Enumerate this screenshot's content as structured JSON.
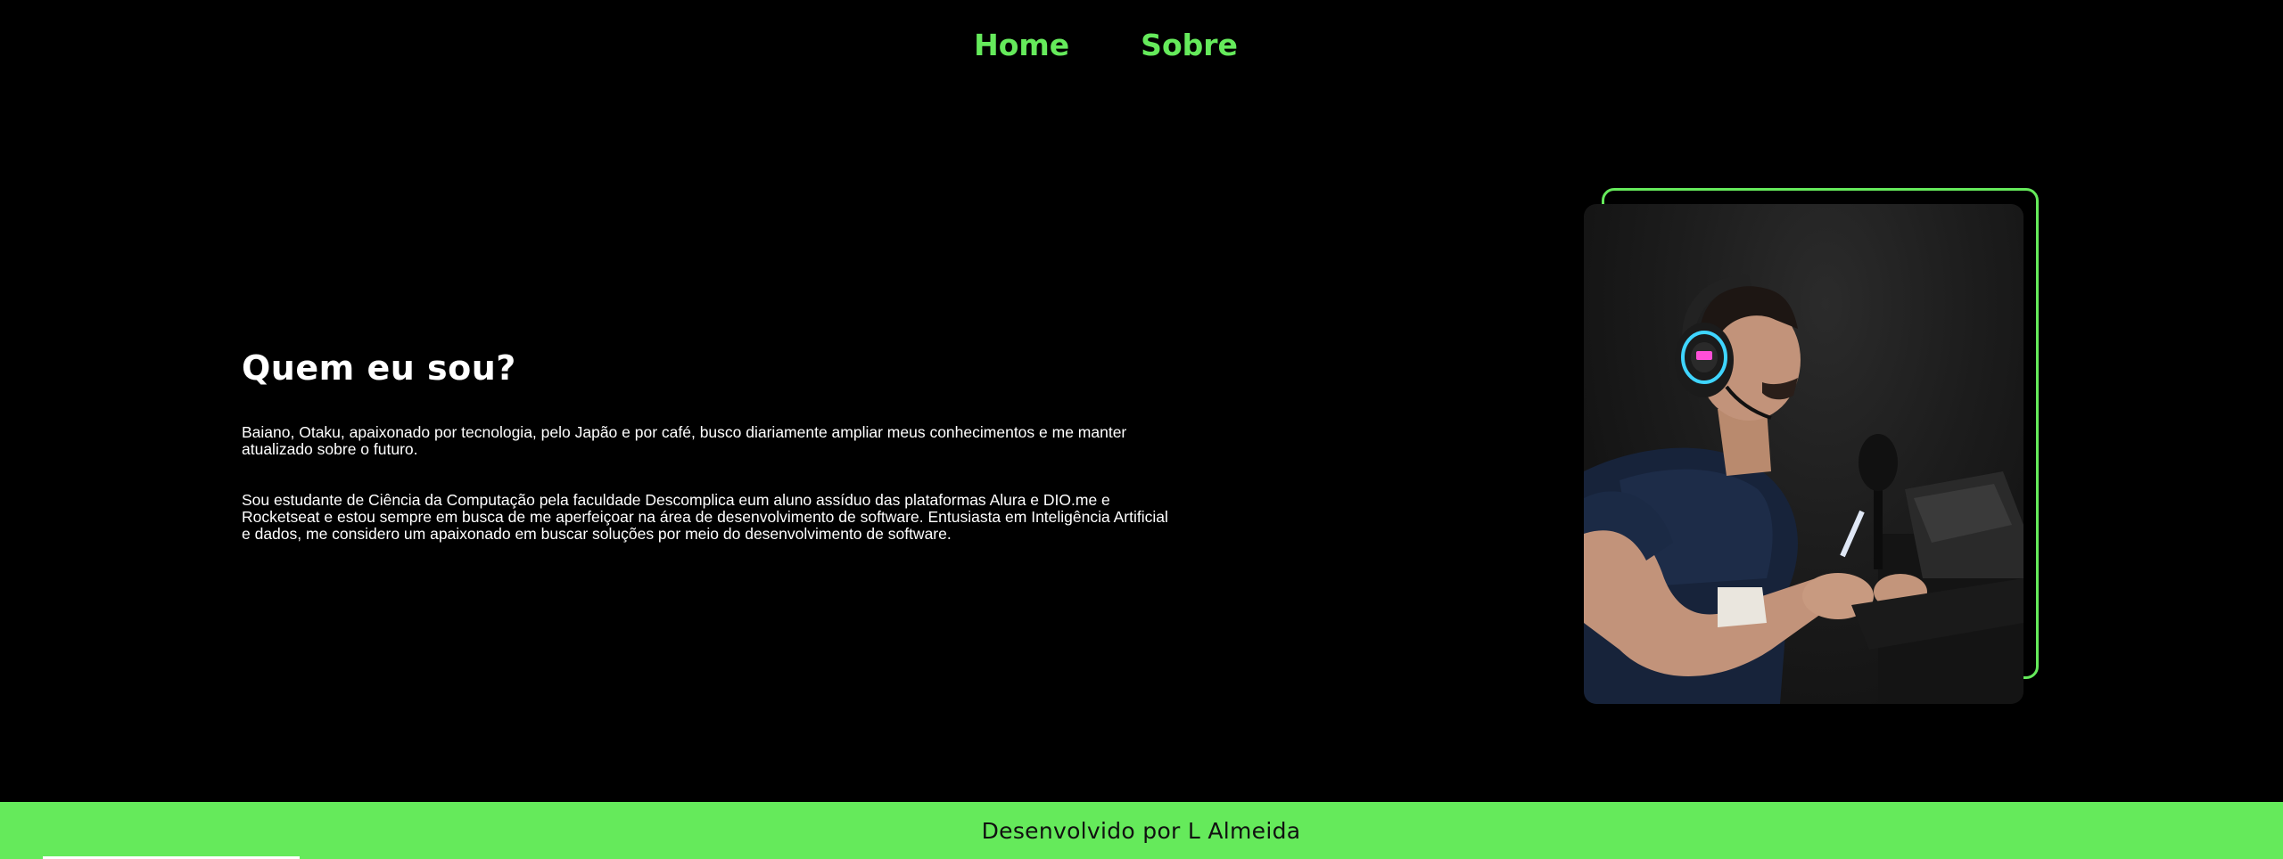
{
  "nav": {
    "items": [
      {
        "label": "Home"
      },
      {
        "label": "Sobre"
      }
    ]
  },
  "about": {
    "title": "Quem eu sou?",
    "paragraphs": [
      "Baiano, Otaku, apaixonado por tecnologia, pelo Japão e por café, busco diariamente ampliar meus conhecimentos e me manter atualizado sobre o futuro.",
      "Sou estudante de Ciência da Computação pela faculdade Descomplica eum aluno assíduo das plataformas Alura e DIO.me e Rocketseat e estou sempre em busca de me aperfeiçoar na área de desenvolvimento de software. Entusiasta em Inteligência Artificial e dados, me considero um apaixonado em buscar soluções por meio do desenvolvimento de software."
    ]
  },
  "footer": {
    "text": "Desenvolvido por L Almeida"
  },
  "colors": {
    "accent": "#65ea5b",
    "background": "#000000",
    "text": "#ffffff"
  }
}
